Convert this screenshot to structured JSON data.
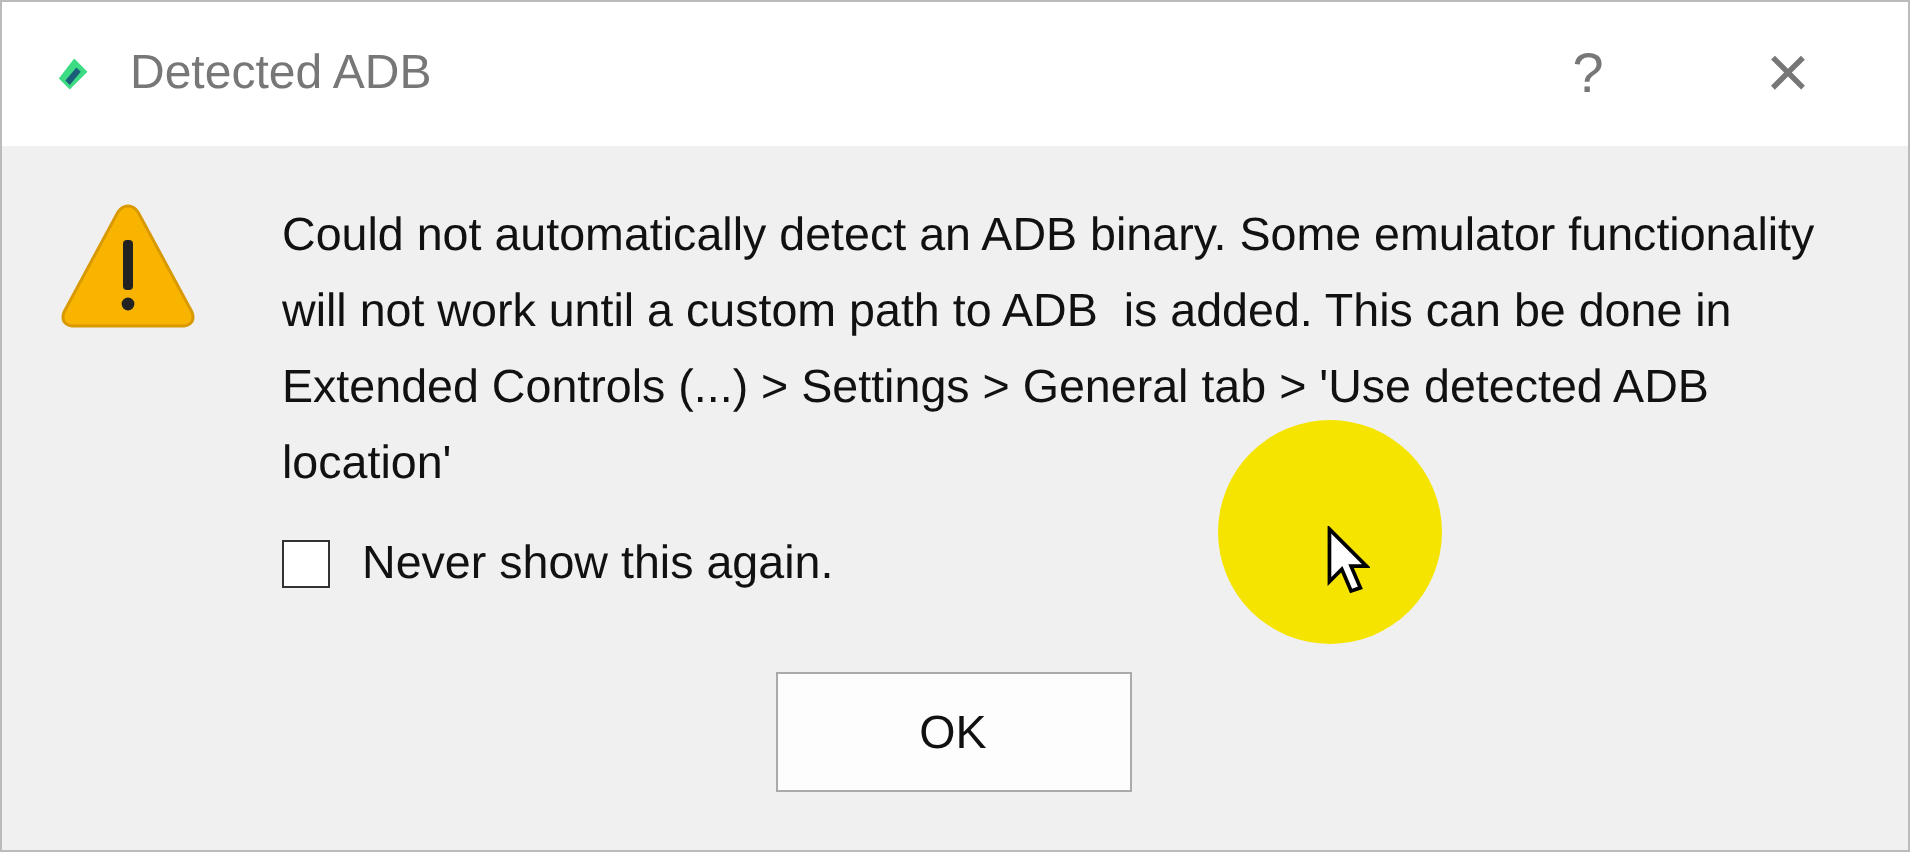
{
  "window": {
    "title": "Detected ADB",
    "help": "?",
    "close": "×"
  },
  "message": "Could not automatically detect an ADB binary. Some emulator functionality will not work until a custom path to ADB  is added. This can be done in Extended Controls (...) > Settings > General tab > 'Use detected ADB location'",
  "checkbox": {
    "label": "Never show this again.",
    "checked": false
  },
  "buttons": [
    "OK"
  ]
}
